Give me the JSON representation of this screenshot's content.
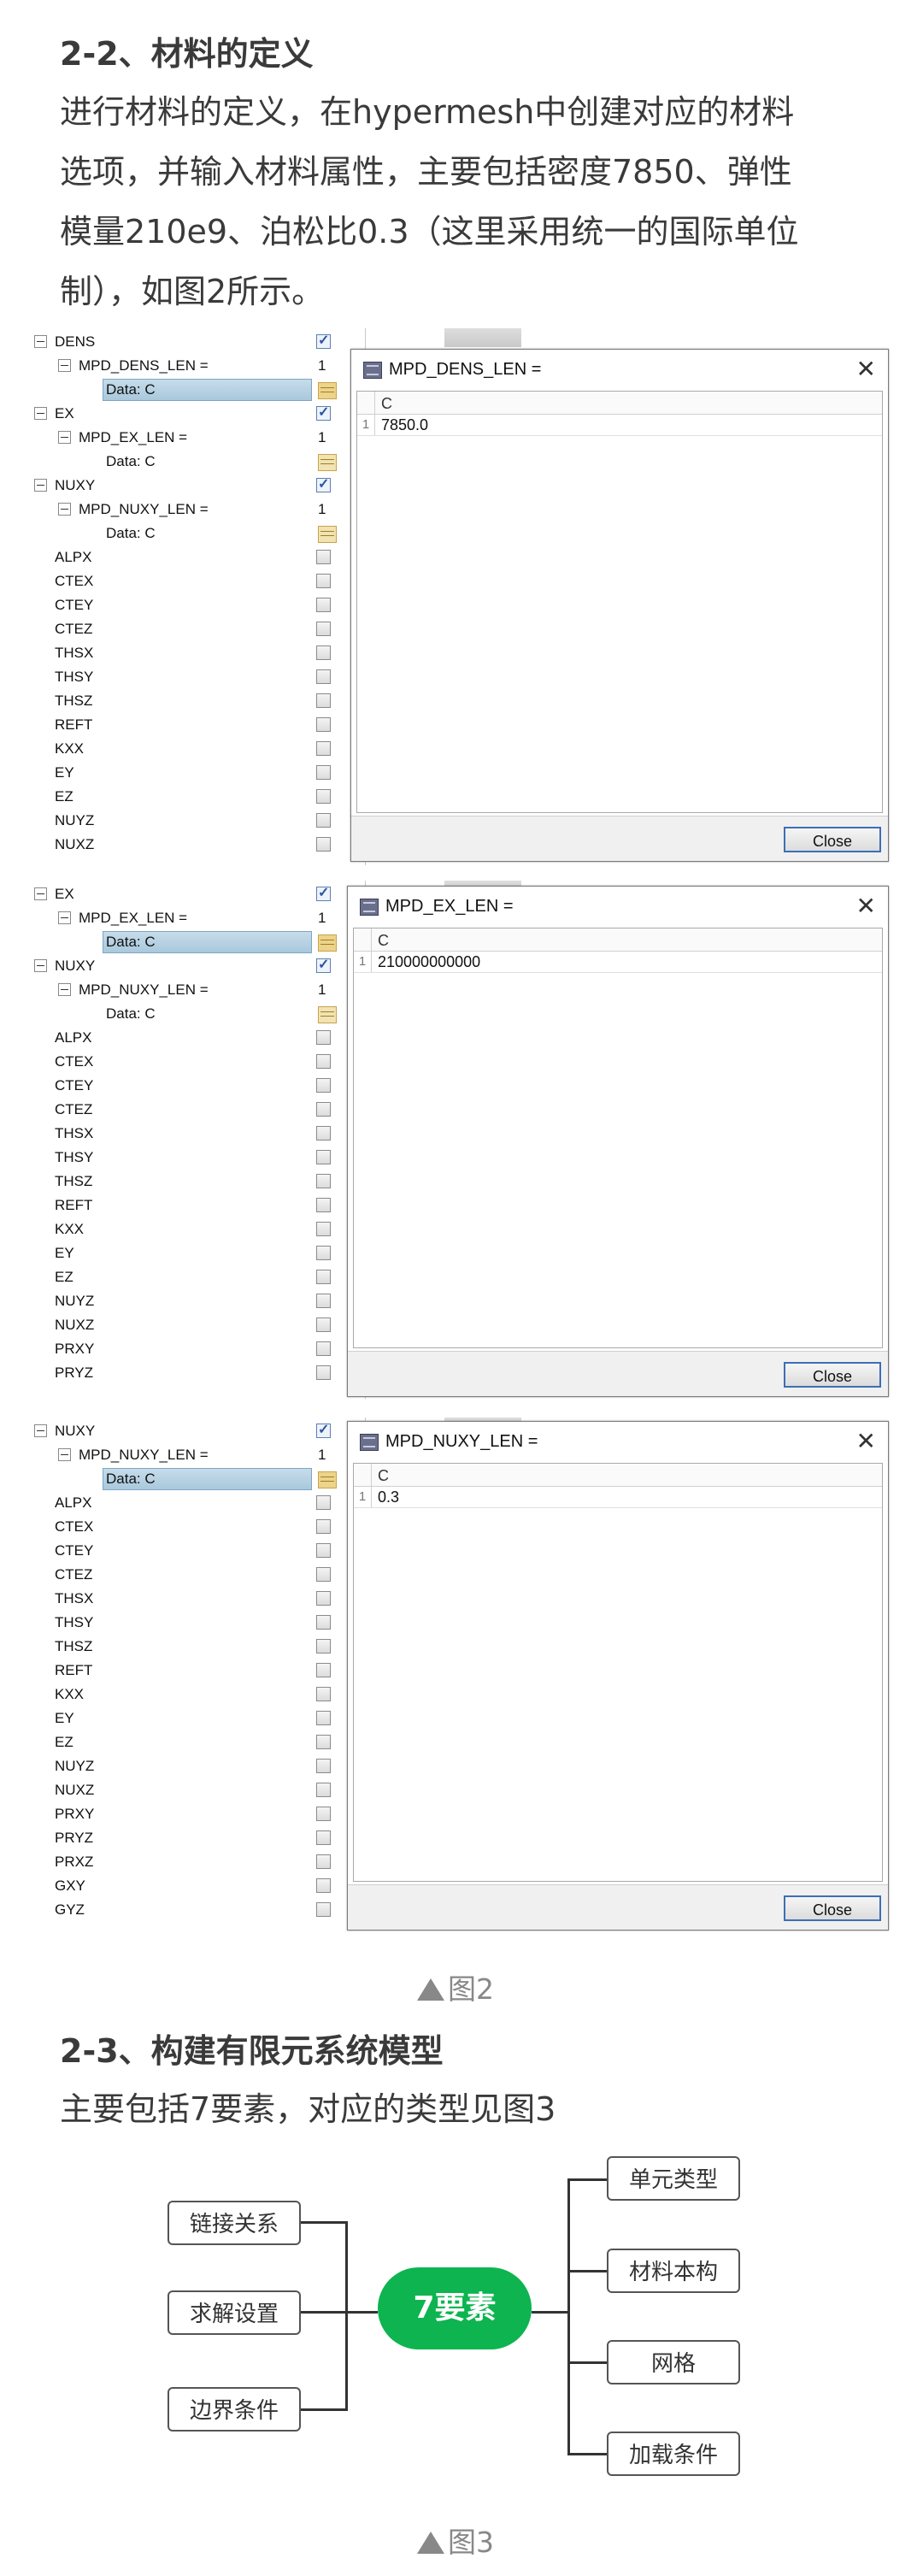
{
  "section_2_2": {
    "heading": "2-2、材料的定义",
    "paragraph_lines": [
      "进行材料的定义，在hypermesh中创建对应的材料",
      "选项，并输入材料属性，主要包括密度7850、弹性",
      "模量210e9、泊松比0.3（这里采用统一的国际单位",
      "制），如图2所示。"
    ]
  },
  "figure2": {
    "caption": "图2",
    "panels": [
      {
        "tree_top": [
          {
            "label": "DENS",
            "level": 0,
            "expand": true,
            "checked": true
          },
          {
            "label": "MPD_DENS_LEN =",
            "level": 1,
            "expand": true,
            "value": "1"
          },
          {
            "label": "Data: C",
            "level": 2,
            "selected": true,
            "table": true
          },
          {
            "label": "EX",
            "level": 0,
            "expand": true,
            "checked": true
          },
          {
            "label": "MPD_EX_LEN =",
            "level": 1,
            "expand": true,
            "value": "1"
          },
          {
            "label": "Data: C",
            "level": 2,
            "table": true
          },
          {
            "label": "NUXY",
            "level": 0,
            "expand": true,
            "checked": true
          },
          {
            "label": "MPD_NUXY_LEN =",
            "level": 1,
            "expand": true,
            "value": "1"
          },
          {
            "label": "Data: C",
            "level": 2,
            "table": true
          }
        ],
        "tree_plain": [
          "ALPX",
          "CTEX",
          "CTEY",
          "CTEZ",
          "THSX",
          "THSY",
          "THSZ",
          "REFT",
          "KXX",
          "EY",
          "EZ",
          "NUYZ",
          "NUXZ"
        ],
        "dialog": {
          "title": "MPD_DENS_LEN =",
          "col": "C",
          "row_num": "1",
          "value": "7850.0",
          "close": "Close"
        }
      },
      {
        "tree_top": [
          {
            "label": "EX",
            "level": 0,
            "expand": true,
            "checked": true
          },
          {
            "label": "MPD_EX_LEN =",
            "level": 1,
            "expand": true,
            "value": "1"
          },
          {
            "label": "Data: C",
            "level": 2,
            "selected": true,
            "table": true
          },
          {
            "label": "NUXY",
            "level": 0,
            "expand": true,
            "checked": true
          },
          {
            "label": "MPD_NUXY_LEN =",
            "level": 1,
            "expand": true,
            "value": "1"
          },
          {
            "label": "Data: C",
            "level": 2,
            "table": true
          }
        ],
        "tree_plain": [
          "ALPX",
          "CTEX",
          "CTEY",
          "CTEZ",
          "THSX",
          "THSY",
          "THSZ",
          "REFT",
          "KXX",
          "EY",
          "EZ",
          "NUYZ",
          "NUXZ",
          "PRXY",
          "PRYZ"
        ],
        "dialog": {
          "title": "MPD_EX_LEN =",
          "col": "C",
          "row_num": "1",
          "value": "210000000000",
          "close": "Close"
        }
      },
      {
        "tree_top": [
          {
            "label": "NUXY",
            "level": 0,
            "expand": true,
            "checked": true
          },
          {
            "label": "MPD_NUXY_LEN =",
            "level": 1,
            "expand": true,
            "value": "1"
          },
          {
            "label": "Data: C",
            "level": 2,
            "selected": true,
            "table": true
          }
        ],
        "tree_plain": [
          "ALPX",
          "CTEX",
          "CTEY",
          "CTEZ",
          "THSX",
          "THSY",
          "THSZ",
          "REFT",
          "KXX",
          "EY",
          "EZ",
          "NUYZ",
          "NUXZ",
          "PRXY",
          "PRYZ",
          "PRXZ",
          "GXY",
          "GYZ"
        ],
        "dialog": {
          "title": "MPD_NUXY_LEN =",
          "col": "C",
          "row_num": "1",
          "value": "0.3",
          "close": "Close"
        }
      }
    ]
  },
  "section_2_3": {
    "heading": "2-3、构建有限元系统模型",
    "paragraph": "主要包括7要素，对应的类型见图3"
  },
  "figure3": {
    "caption": "图3",
    "center": "7要素",
    "left": [
      "链接关系",
      "求解设置",
      "边界条件"
    ],
    "right": [
      "单元类型",
      "材料本构",
      "网格",
      "加载条件"
    ]
  }
}
